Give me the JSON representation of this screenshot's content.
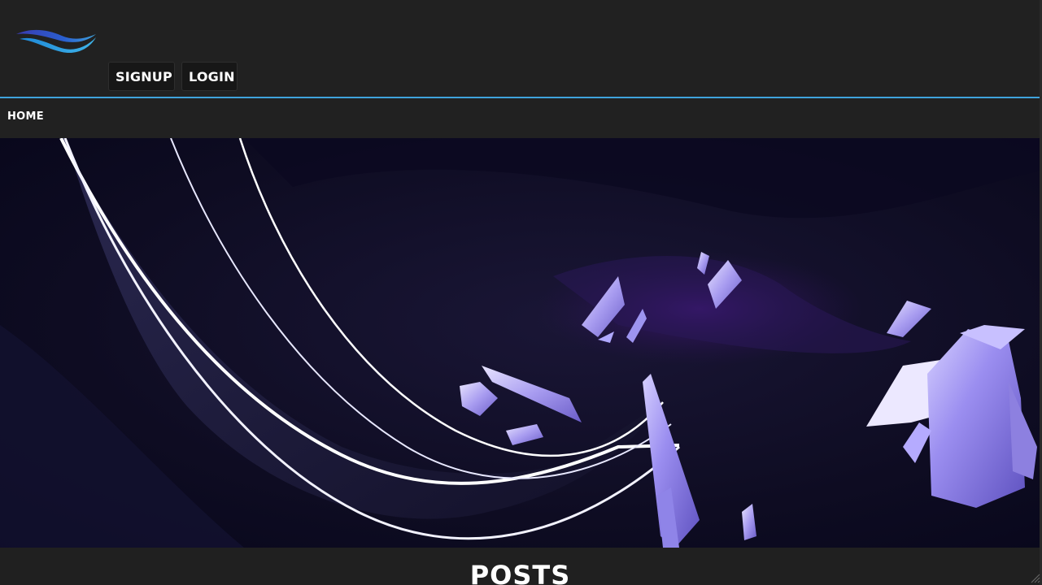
{
  "header": {
    "logo_icon": "wave-logo-icon",
    "signup_label": "SIGNUP",
    "login_label": "LOGIN"
  },
  "nav": {
    "home_label": "HOME"
  },
  "hero": {
    "description_icon": "crystal-cave-banner-image"
  },
  "posts": {
    "title": "POSTS"
  },
  "colors": {
    "accent": "#3fa3dc",
    "background": "#202020",
    "button_bg": "#171717"
  }
}
